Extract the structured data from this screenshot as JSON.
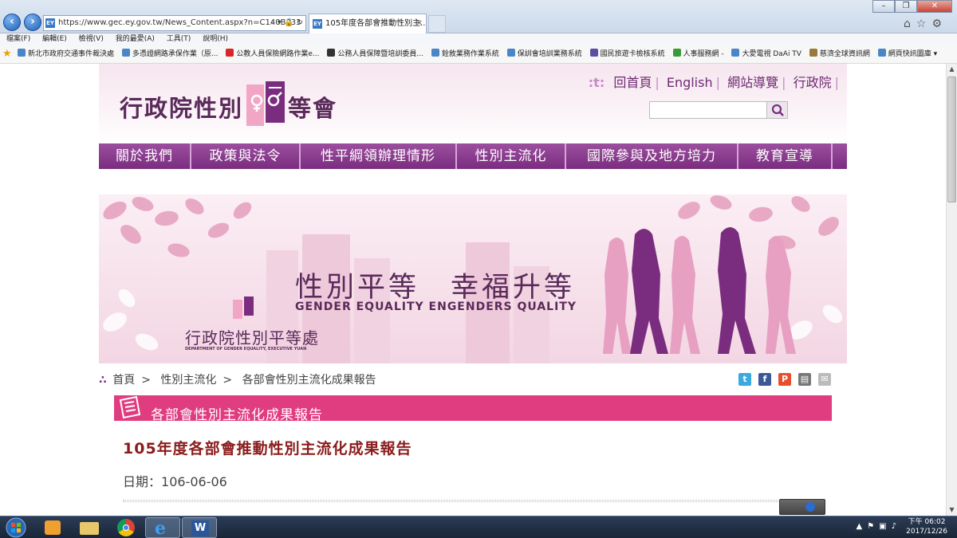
{
  "browser": {
    "url": "https://www.gec.ey.gov.tw/News_Content.aspx?n=C140B333",
    "tab_title": "105年度各部會推動性別主...",
    "menu": [
      "檔案(F)",
      "編輯(E)",
      "檢視(V)",
      "我的最愛(A)",
      "工具(T)",
      "說明(H)"
    ],
    "favorites": [
      "新北市政府交通事件裁決處",
      "多憑證網路承保作業（原...",
      "公教人員保險網路作業e...",
      "公務人員保障暨培訓委員...",
      "銓敘業務作業系統",
      "保訓會培訓業務系統",
      "國民旅遊卡檢核系統",
      "人事服務網 -",
      "大愛電視 DaAi TV",
      "慈濟全球資訊網",
      "網頁快訊圖庫"
    ]
  },
  "site": {
    "logo_left": "行政院性別",
    "logo_right": "等會",
    "top_links": [
      "回首頁",
      "English",
      "網站導覽",
      "行政院"
    ],
    "search_placeholder": "",
    "nav": [
      "關於我們",
      "政策與法令",
      "性平綱領辦理情形",
      "性別主流化",
      "國際參與及地方培力",
      "教育宣導"
    ],
    "banner": {
      "slogan": "性別平等　幸福升等",
      "slogan_en": "GENDER EQUALITY ENGENDERS QUALITY",
      "dept_name": "行政院性別平等處",
      "dept_name_en": "DEPARTMENT OF GENDER EQUALITY, EXECUTIVE YUAN"
    },
    "breadcrumb": [
      "首頁",
      "性別主流化",
      "各部會性別主流化成果報告"
    ],
    "share_icons": [
      "twitter-icon",
      "facebook-icon",
      "plurk-icon",
      "print-icon",
      "mail-icon"
    ],
    "section_title": "各部會性別主流化成果報告",
    "article": {
      "title": "105年度各部會推動性別主流化成果報告",
      "date_label": "日期：",
      "date_value": "106-06-06"
    }
  },
  "taskbar": {
    "clock_period": "下午 06:02",
    "clock_date": "2017/12/26"
  },
  "colors": {
    "nav_purple": "#7a2d7f",
    "section_pink": "#e03c80",
    "article_title": "#8b1c1c"
  }
}
